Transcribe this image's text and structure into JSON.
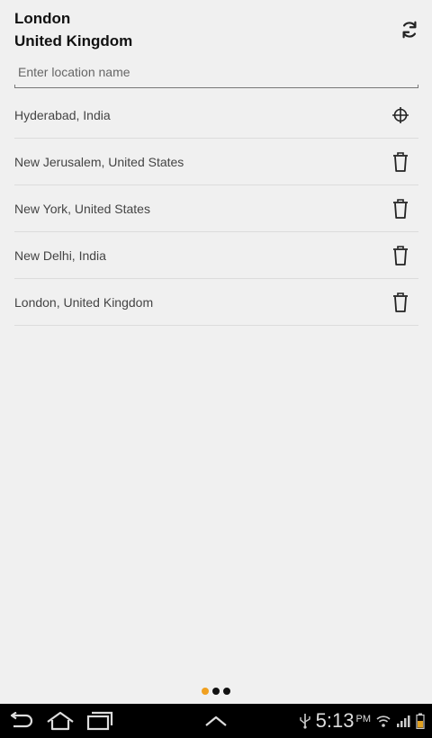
{
  "header": {
    "city": "London",
    "country": "United Kingdom",
    "refresh_icon": "refresh-icon"
  },
  "search": {
    "placeholder": "Enter location name",
    "value": ""
  },
  "locations": [
    {
      "label": "Hyderabad, India",
      "icon": "crosshair-icon"
    },
    {
      "label": "New Jerusalem, United States",
      "icon": "trash-icon"
    },
    {
      "label": "New York, United States",
      "icon": "trash-icon"
    },
    {
      "label": "New Delhi, India",
      "icon": "trash-icon"
    },
    {
      "label": "London, United Kingdom",
      "icon": "trash-icon"
    }
  ],
  "pager": {
    "active_index": 0,
    "count": 3,
    "active_color": "#f0a020",
    "inactive_color": "#111111"
  },
  "system_bar": {
    "time": "5:13",
    "ampm": "PM",
    "icons": [
      "back-icon",
      "home-icon",
      "recent-apps-icon",
      "up-chevron-icon",
      "usb-icon",
      "wifi-icon",
      "signal-icon",
      "battery-icon"
    ]
  }
}
